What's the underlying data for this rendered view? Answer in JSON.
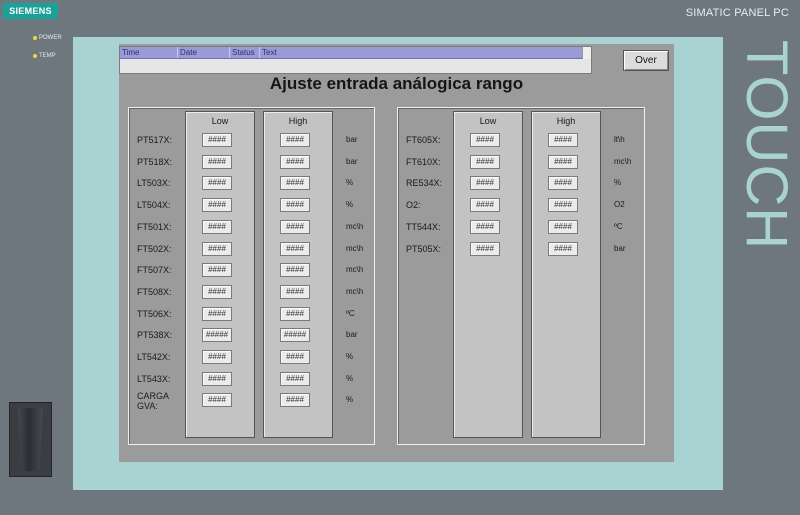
{
  "device": {
    "brand": "SIEMENS",
    "model": "SIMATIC PANEL PC",
    "side_label": "TOUCH",
    "led_power": "POWER",
    "led_temp": "TEMP"
  },
  "alarm_view": {
    "columns": [
      "Time",
      "Date",
      "Status",
      "Text"
    ]
  },
  "over_button": "Over",
  "title": "Ajuste entrada análogica rango",
  "col_low": "Low",
  "col_high": "High",
  "left_rows": [
    {
      "label": "PT517X:",
      "low": "####",
      "high": "####",
      "unit": "bar"
    },
    {
      "label": "PT518X:",
      "low": "####",
      "high": "####",
      "unit": "bar"
    },
    {
      "label": "LT503X:",
      "low": "####",
      "high": "####",
      "unit": "%"
    },
    {
      "label": "LT504X:",
      "low": "####",
      "high": "####",
      "unit": "%"
    },
    {
      "label": "FT501X:",
      "low": "####",
      "high": "####",
      "unit": "mc\\h"
    },
    {
      "label": "FT502X:",
      "low": "####",
      "high": "####",
      "unit": "mc\\h"
    },
    {
      "label": "FT507X:",
      "low": "####",
      "high": "####",
      "unit": "mc\\h"
    },
    {
      "label": "FT508X:",
      "low": "####",
      "high": "####",
      "unit": "mc\\h"
    },
    {
      "label": "TT506X:",
      "low": "####",
      "high": "####",
      "unit": "ºC"
    },
    {
      "label": "PT538X:",
      "low": "#####",
      "high": "#####",
      "unit": "bar"
    },
    {
      "label": "LT542X:",
      "low": "####",
      "high": "####",
      "unit": "%"
    },
    {
      "label": "LT543X:",
      "low": "####",
      "high": "####",
      "unit": "%"
    },
    {
      "label": "CARGA GVA:",
      "low": "####",
      "high": "####",
      "unit": "%"
    }
  ],
  "right_rows": [
    {
      "label": "FT605X:",
      "low": "####",
      "high": "####",
      "unit": "lt\\h"
    },
    {
      "label": "FT610X:",
      "low": "####",
      "high": "####",
      "unit": "mc\\h"
    },
    {
      "label": "RE534X:",
      "low": "####",
      "high": "####",
      "unit": "%"
    },
    {
      "label": "O2:",
      "low": "####",
      "high": "####",
      "unit": "O2"
    },
    {
      "label": "TT544X:",
      "low": "####",
      "high": "####",
      "unit": "ºC"
    },
    {
      "label": "PT505X:",
      "low": "####",
      "high": "####",
      "unit": "bar"
    }
  ]
}
